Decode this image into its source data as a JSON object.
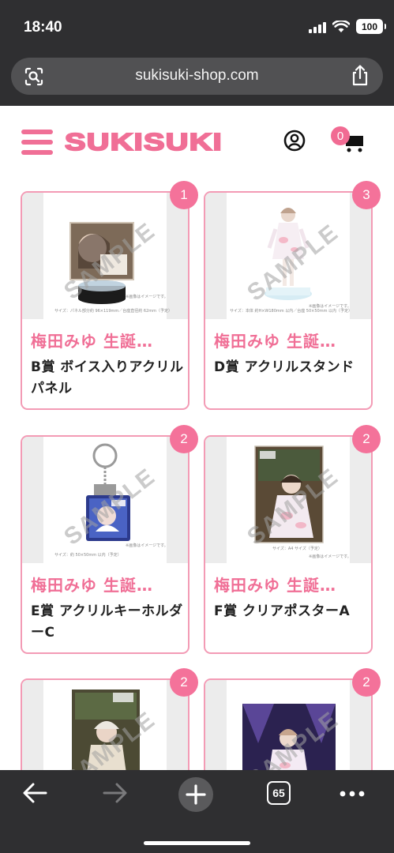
{
  "status_bar": {
    "time": "18:40",
    "battery": "100"
  },
  "browser": {
    "url": "sukisuki-shop.com",
    "tab_count": "65"
  },
  "header": {
    "logo_text": "SUKISUKI",
    "cart_count": "0",
    "brand_color": "#f06f96"
  },
  "products": [
    {
      "title": "梅田みゆ 生誕…",
      "name": "B賞 ボイス入りアクリルパネル",
      "badge": "1",
      "watermark": "SAMPLE",
      "caption": "サイズ：パネル部分約 96×119mm／台座直径約 62mm（予定）",
      "note": "※画像はイメージです。"
    },
    {
      "title": "梅田みゆ 生誕…",
      "name": "D賞 アクリルスタンド",
      "badge": "3",
      "watermark": "SAMPLE",
      "caption": "サイズ：本体 約H×W180mm 以内／台座 50×50mm 以内（予定）",
      "note": "※画像はイメージです。"
    },
    {
      "title": "梅田みゆ 生誕…",
      "name": "E賞 アクリルキーホルダーC",
      "badge": "2",
      "watermark": "SAMPLE",
      "caption": "サイズ：約 50×50mm 以内（予定）",
      "note": "※画像はイメージです。"
    },
    {
      "title": "梅田みゆ 生誕…",
      "name": "F賞 クリアポスターA",
      "badge": "2",
      "watermark": "SAMPLE",
      "caption": "サイズ：A4 サイズ（予定）",
      "note": "※画像はイメージです。"
    },
    {
      "title": "",
      "name": "",
      "badge": "2",
      "watermark": "SAMPLE",
      "caption": "",
      "note": ""
    },
    {
      "title": "",
      "name": "",
      "badge": "2",
      "watermark": "SAMPLE",
      "caption": "",
      "note": ""
    }
  ]
}
